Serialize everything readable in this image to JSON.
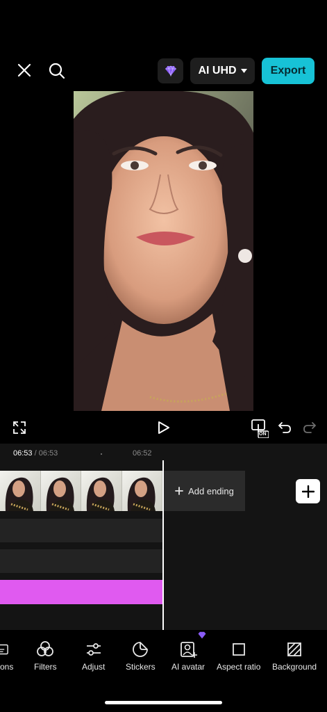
{
  "topbar": {
    "quality_label": "AI UHD",
    "export_label": "Export"
  },
  "player": {
    "current_time": "06:53",
    "separator": "/",
    "total_time": "06:53",
    "ruler_mark": "06:52",
    "snap_badge": "ON"
  },
  "timeline": {
    "add_ending_label": "Add ending"
  },
  "toolbar": {
    "items": [
      {
        "label": "tions",
        "icon": "captions-icon"
      },
      {
        "label": "Filters",
        "icon": "filters-icon"
      },
      {
        "label": "Adjust",
        "icon": "adjust-icon"
      },
      {
        "label": "Stickers",
        "icon": "stickers-icon"
      },
      {
        "label": "AI avatar",
        "icon": "ai-avatar-icon"
      },
      {
        "label": "Aspect ratio",
        "icon": "aspect-ratio-icon"
      },
      {
        "label": "Background",
        "icon": "background-icon"
      }
    ]
  },
  "colors": {
    "accent": "#17c2d6",
    "pro": "#8a5cf6",
    "effect_track": "#e05af0"
  }
}
